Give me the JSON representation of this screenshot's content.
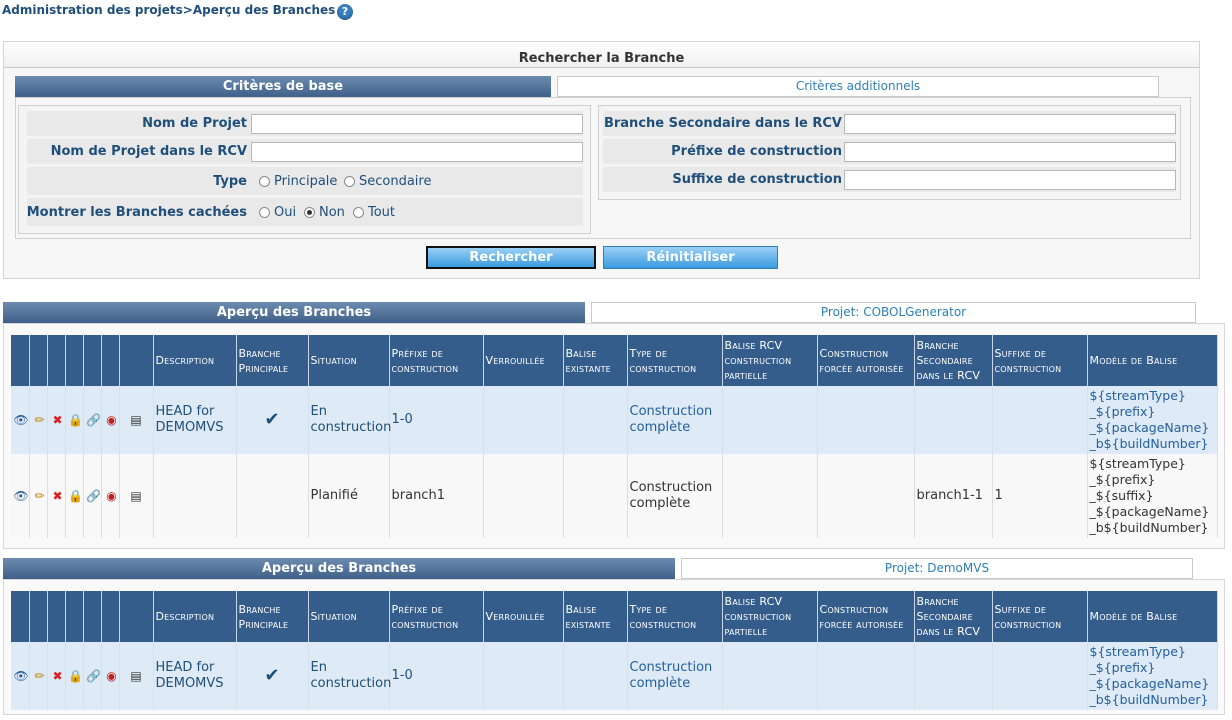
{
  "breadcrumb": "Administration des projets>Aperçu des Branches",
  "help_glyph": "?",
  "search": {
    "title": "Rechercher la Branche",
    "tab_basic": "Critères de base",
    "tab_additional": "Critères additionnels",
    "labels": {
      "project_name": "Nom de Projet",
      "project_name_rcv": "Nom de Projet dans le RCV",
      "type": "Type",
      "show_hidden": "Montrer les Branches cachées",
      "secondary_branch_rcv": "Branche Secondaire dans le RCV",
      "build_prefix": "Préfixe de construction",
      "build_suffix": "Suffixe de construction"
    },
    "type_options": [
      "Principale",
      "Secondaire"
    ],
    "hidden_options": [
      "Oui",
      "Non",
      "Tout"
    ],
    "hidden_selected": "Non",
    "values": {
      "project_name": "",
      "project_name_rcv": "",
      "secondary_branch_rcv": "",
      "build_prefix": "",
      "build_suffix": ""
    },
    "search_button": "Rechercher",
    "reset_button": "Réinitialiser"
  },
  "columns": [
    "Description",
    "Branche Principale",
    "Situation",
    "Préfixe de construction",
    "Verrouillée",
    "Balise existante",
    "Type de construction",
    "Balise RCV construction partielle",
    "Construction forcée autorisée",
    "Branche Secondaire dans le RCV",
    "Suffixe de construction",
    "Modèle de Balise"
  ],
  "sections": [
    {
      "title": "Aperçu des Branches",
      "project_tab": "Projet: COBOLGenerator",
      "rows": [
        {
          "description": "HEAD for DEMOMVS",
          "principal": true,
          "situation": "En construction",
          "prefix": "1-0",
          "locked": "",
          "existing_tag": "",
          "build_type": "Construction complète",
          "partial_tag": "",
          "forced": "",
          "secondary_branch": "",
          "suffix": "",
          "tag_model": [
            "${streamType}",
            "_${prefix}",
            "_${packageName}",
            "_b${buildNumber}"
          ]
        },
        {
          "description": "",
          "principal": false,
          "situation": "Planifié",
          "prefix": "branch1",
          "locked": "",
          "existing_tag": "",
          "build_type": "Construction complète",
          "partial_tag": "",
          "forced": "",
          "secondary_branch": "branch1-1",
          "suffix": "1",
          "tag_model": [
            "${streamType}",
            "_${prefix}",
            "_${suffix}",
            "_${packageName}",
            "_b${buildNumber}"
          ]
        }
      ]
    },
    {
      "title": "Aperçu des Branches",
      "project_tab": "Projet: DemoMVS",
      "rows": [
        {
          "description": "HEAD for DEMOMVS",
          "principal": true,
          "situation": "En construction",
          "prefix": "1-0",
          "locked": "",
          "existing_tag": "",
          "build_type": "Construction complète",
          "partial_tag": "",
          "forced": "",
          "secondary_branch": "",
          "suffix": "",
          "tag_model": [
            "${streamType}",
            "_${prefix}",
            "_${packageName}",
            "_b${buildNumber}"
          ]
        }
      ]
    }
  ],
  "row_actions": [
    "view-icon",
    "edit-icon",
    "delete-icon",
    "lock-icon",
    "link-icon",
    "hide-icon",
    "details-icon"
  ],
  "colors": {
    "header_bg": "#355d8c",
    "row_blue": "#deeaf5",
    "link": "#2360a0",
    "button": "#3b9be0"
  }
}
